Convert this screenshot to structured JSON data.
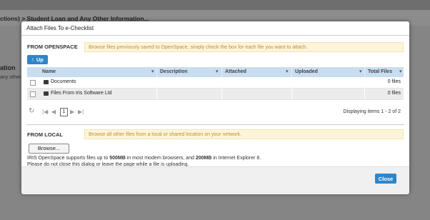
{
  "background": {
    "breadcrumb": "ctions) > Student Loan and Any Other Information...",
    "side_heading": "ation",
    "side_text": "any other"
  },
  "dialog": {
    "title": "Attach Files To e-Checklist",
    "openspace": {
      "label": "FROM OPENSPACE",
      "hint": "Browse files previously saved to OpenSpace, simply check the box for each file you want to attach.",
      "up_button": "Up",
      "columns": [
        "Name",
        "Description",
        "Attached",
        "Uploaded",
        "Total Files"
      ],
      "rows": [
        {
          "name": "Documents",
          "description": "",
          "attached": "",
          "uploaded": "",
          "total": "0 files"
        },
        {
          "name": "Files From Iris Software Ltd",
          "description": "",
          "attached": "",
          "uploaded": "",
          "total": "0 files"
        }
      ],
      "pager": {
        "current_page": "1",
        "info": "Displaying items 1 - 2 of 2"
      }
    },
    "local": {
      "label": "FROM LOCAL",
      "hint": "Browse all other files from a local or shared location on your network.",
      "browse_button": "Browse...",
      "note_pre": "IRIS OpenSpace supports files up to ",
      "note_b1": "500MB",
      "note_mid": " in most modern browsers, and ",
      "note_b2": "200MB",
      "note_post": " in Internet Explorer 8.",
      "note_line2": "Please do not close this dialog or leave the page while a file is uploading."
    },
    "close_button": "Close"
  }
}
